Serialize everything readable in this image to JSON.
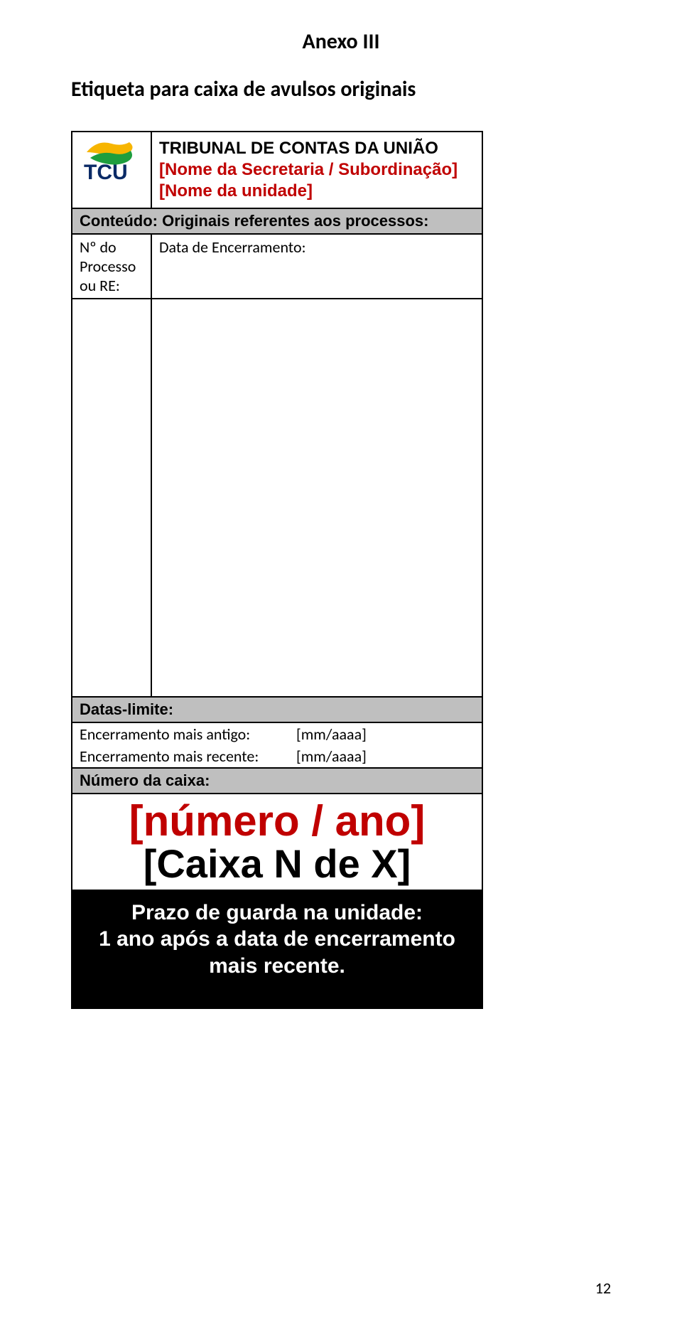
{
  "annex_title": "Anexo III",
  "subtitle": "Etiqueta para caixa de avulsos originais",
  "header": {
    "org": "TRIBUNAL DE CONTAS DA UNIÃO",
    "line2": "[Nome da Secretaria / Subordinação]",
    "line3": "[Nome da unidade]"
  },
  "conteudo_label": "Conteúdo: Originais referentes aos processos:",
  "col_left": "Nº do Processo ou RE:",
  "col_right": "Data de Encerramento:",
  "datas_limite_label": "Datas-limite:",
  "enc_antigo_label": "Encerramento mais antigo:",
  "enc_antigo_value": "[mm/aaaa]",
  "enc_recente_label": "Encerramento mais recente:",
  "enc_recente_value": "[mm/aaaa]",
  "numero_caixa_label": "Número da caixa:",
  "numero_ano": "[número / ano]",
  "caixa_n_x": "[Caixa N de X]",
  "prazo_line1": "Prazo de guarda na unidade:",
  "prazo_line2": "1 ano após a data de encerramento",
  "prazo_line3": "mais recente.",
  "page_number": "12"
}
